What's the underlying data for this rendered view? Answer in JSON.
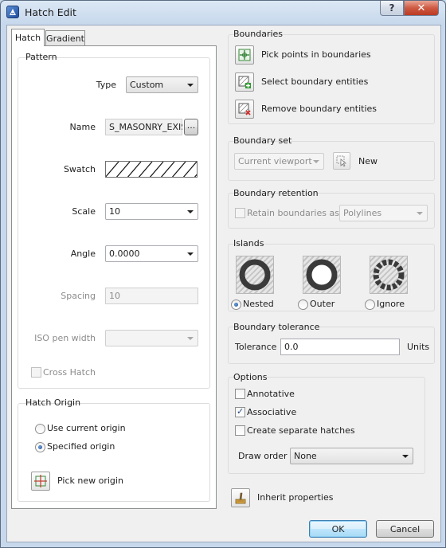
{
  "window": {
    "title": "Hatch Edit",
    "help_label": "?",
    "close_label": "✕"
  },
  "tabs": [
    {
      "label": "Hatch"
    },
    {
      "label": "Gradient"
    }
  ],
  "pattern": {
    "title": "Pattern",
    "type_label": "Type",
    "type_value": "Custom",
    "name_label": "Name",
    "name_value": "S_MASONRY_EXIST",
    "browse_label": "...",
    "swatch_label": "Swatch",
    "scale_label": "Scale",
    "scale_value": "10",
    "angle_label": "Angle",
    "angle_value": "0.0000",
    "spacing_label": "Spacing",
    "spacing_value": "10",
    "iso_label": "ISO pen width",
    "iso_value": "",
    "cross_hatch_label": "Cross Hatch"
  },
  "hatch_origin": {
    "title": "Hatch Origin",
    "use_current_label": "Use current origin",
    "specified_label": "Specified origin",
    "selected": "specified",
    "pick_label": "Pick new origin"
  },
  "boundaries": {
    "title": "Boundaries",
    "pick_points_label": "Pick points in boundaries",
    "select_entities_label": "Select boundary entities",
    "remove_entities_label": "Remove boundary entities"
  },
  "boundary_set": {
    "title": "Boundary set",
    "viewport_value": "Current viewport",
    "new_label": "New"
  },
  "boundary_retention": {
    "title": "Boundary retention",
    "retain_label": "Retain boundaries as",
    "retain_checked": false,
    "type_value": "Polylines"
  },
  "islands": {
    "title": "Islands",
    "options": [
      {
        "label": "Nested"
      },
      {
        "label": "Outer"
      },
      {
        "label": "Ignore"
      }
    ],
    "selected": "Nested"
  },
  "tolerance": {
    "title": "Boundary tolerance",
    "label": "Tolerance",
    "value": "0.0",
    "units": "Units"
  },
  "options": {
    "title": "Options",
    "annotative_label": "Annotative",
    "annotative_checked": false,
    "associative_label": "Associative",
    "associative_checked": true,
    "separate_label": "Create separate hatches",
    "separate_checked": false,
    "draw_order_label": "Draw order",
    "draw_order_value": "None"
  },
  "inherit_label": "Inherit properties",
  "footer": {
    "ok_label": "OK",
    "cancel_label": "Cancel"
  }
}
